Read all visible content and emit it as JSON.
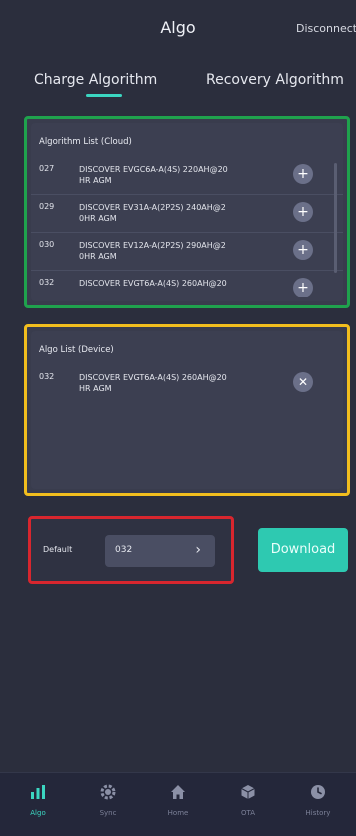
{
  "header": {
    "title": "Algo",
    "disconnect_label": "Disconnect"
  },
  "tabs": [
    {
      "label": "Charge Algorithm",
      "active": true
    },
    {
      "label": "Recovery Algorithm",
      "active": false
    }
  ],
  "cloud_list": {
    "title": "Algorithm List (Cloud)",
    "items": [
      {
        "num": "027",
        "name": "DISCOVER EVGC6A-A(4S) 220AH@20 HR AGM"
      },
      {
        "num": "029",
        "name": "DISCOVER EV31A-A(2P2S) 240AH@2 0HR AGM"
      },
      {
        "num": "030",
        "name": "DISCOVER EV12A-A(2P2S) 290AH@2 0HR AGM"
      },
      {
        "num": "032",
        "name": "DISCOVER EVGT6A-A(4S) 260AH@20"
      }
    ],
    "add_icon": "plus-circle-icon"
  },
  "device_list": {
    "title": "Algo List (Device)",
    "items": [
      {
        "num": "032",
        "name": "DISCOVER EVGT6A-A(4S) 260AH@20 HR AGM"
      }
    ],
    "remove_icon": "close-circle-icon"
  },
  "default": {
    "label": "Default",
    "value": "032"
  },
  "download_label": "Download",
  "nav": [
    {
      "label": "Algo",
      "icon": "bar-chart-icon",
      "active": true
    },
    {
      "label": "Sync",
      "icon": "gear-icon",
      "active": false
    },
    {
      "label": "Home",
      "icon": "home-icon",
      "active": false
    },
    {
      "label": "OTA",
      "icon": "cube-icon",
      "active": false
    },
    {
      "label": "History",
      "icon": "clock-icon",
      "active": false
    }
  ],
  "colors": {
    "background": "#2b2e3d",
    "accent": "#2ec9b1",
    "highlight_cloud": "#1fa24d",
    "highlight_device": "#f2be1e",
    "highlight_default": "#d8262e"
  }
}
